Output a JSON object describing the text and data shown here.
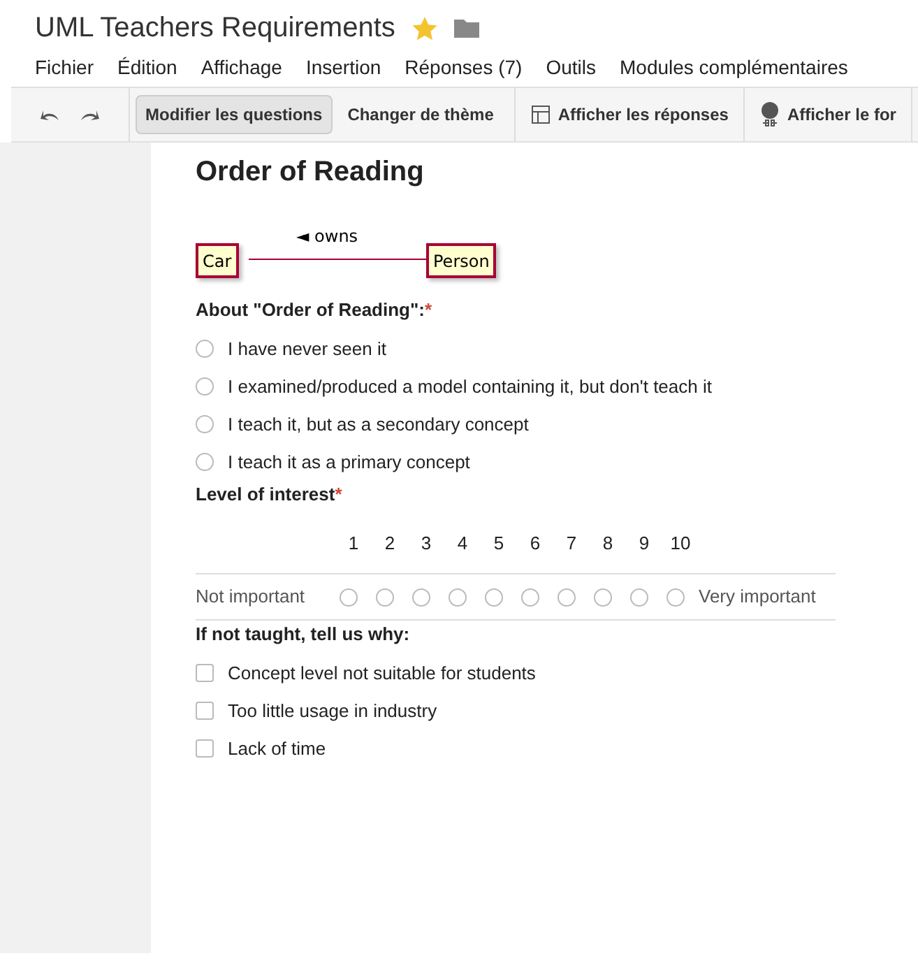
{
  "document": {
    "title": "UML Teachers Requirements",
    "starred": true
  },
  "menu": [
    "Fichier",
    "Édition",
    "Affichage",
    "Insertion",
    "Réponses (7)",
    "Outils",
    "Modules complémentaires"
  ],
  "toolbar": [
    {
      "label": "Modifier les questions",
      "selected": true,
      "kind": "text"
    },
    {
      "label": "Changer de thème",
      "selected": false,
      "kind": "text"
    },
    {
      "label": "Afficher les réponses",
      "selected": false,
      "kind": "table"
    },
    {
      "label": "Afficher le for",
      "selected": false,
      "kind": "globe"
    }
  ],
  "section": {
    "title": "Order of Reading",
    "diagram": {
      "left": "Car",
      "right": "Person",
      "label": "◄ owns"
    }
  },
  "questions": [
    {
      "kind": "radio",
      "title": "About \"Order of Reading\":",
      "required_mark": "*",
      "options": [
        {
          "label": "I have never seen it",
          "checked": false
        },
        {
          "label": "I examined/produced a model containing it, but don't teach it",
          "checked": false
        },
        {
          "label": "I teach it, but as a secondary concept",
          "checked": false
        },
        {
          "label": "I teach it as a primary concept",
          "checked": false
        }
      ]
    },
    {
      "kind": "scale",
      "title": "Level of interest",
      "required_mark": "*",
      "low": "Not important",
      "high": "Very important",
      "points": [
        {
          "label": "1",
          "selected": false
        },
        {
          "label": "2",
          "selected": false
        },
        {
          "label": "3",
          "selected": false
        },
        {
          "label": "4",
          "selected": false
        },
        {
          "label": "5",
          "selected": false
        },
        {
          "label": "6",
          "selected": false
        },
        {
          "label": "7",
          "selected": false
        },
        {
          "label": "8",
          "selected": false
        },
        {
          "label": "9",
          "selected": false
        },
        {
          "label": "10",
          "selected": false
        }
      ]
    },
    {
      "kind": "checkbox",
      "title": "If not taught, tell us why:",
      "options": [
        {
          "label": "Concept level not suitable for students",
          "checked": false
        },
        {
          "label": "Too little usage in industry",
          "checked": false
        },
        {
          "label": "Lack of time",
          "checked": false
        }
      ]
    }
  ]
}
